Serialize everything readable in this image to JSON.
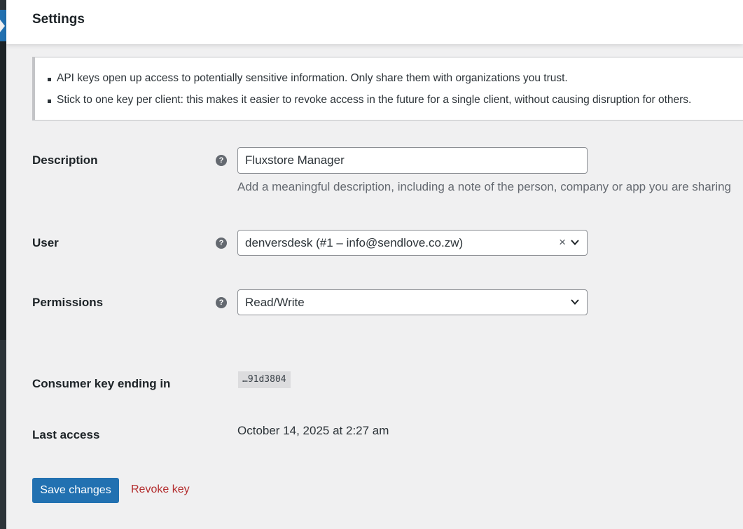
{
  "header": {
    "title": "Settings"
  },
  "notice": {
    "items": [
      "API keys open up access to potentially sensitive information. Only share them with organizations you trust.",
      "Stick to one key per client: this makes it easier to revoke access in the future for a single client, without causing disruption for others."
    ]
  },
  "form": {
    "description": {
      "label": "Description",
      "value": "Fluxstore Manager",
      "help": "Add a meaningful description, including a note of the person, company or app you are sharing"
    },
    "user": {
      "label": "User",
      "selected": "denversdesk (#1 – info@sendlove.co.zw)",
      "clear_symbol": "×"
    },
    "permissions": {
      "label": "Permissions",
      "selected": "Read/Write"
    },
    "consumer_key": {
      "label": "Consumer key ending in",
      "value": "…91d3804"
    },
    "last_access": {
      "label": "Last access",
      "value": "October 14, 2025 at 2:27 am"
    },
    "help_icon_glyph": "?"
  },
  "actions": {
    "save_label": "Save changes",
    "revoke_label": "Revoke key"
  },
  "colors": {
    "primary": "#2271b1",
    "danger": "#b32d2e",
    "background": "#f0f0f1"
  }
}
